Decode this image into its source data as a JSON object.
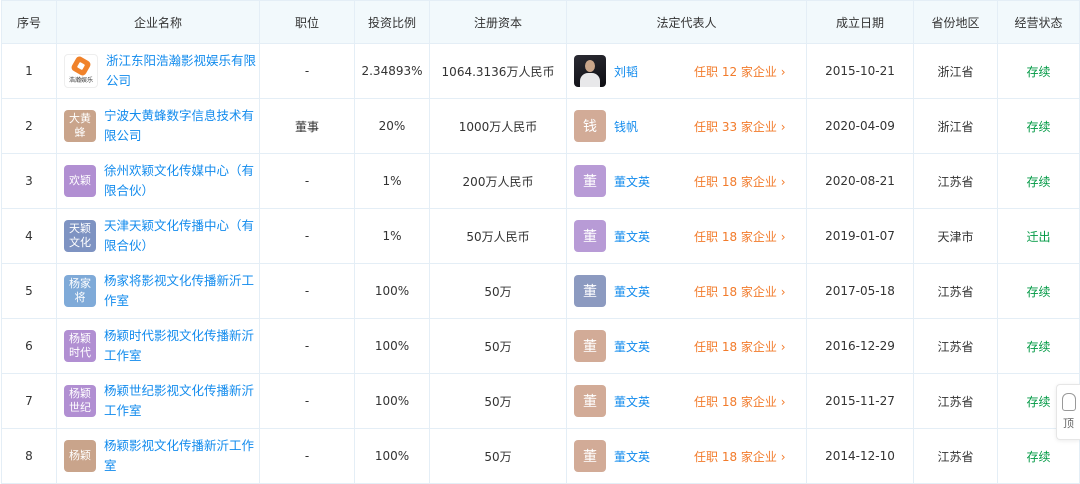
{
  "headers": [
    "序号",
    "企业名称",
    "职位",
    "投资比例",
    "注册资本",
    "法定代表人",
    "成立日期",
    "省份地区",
    "经营状态"
  ],
  "rows": [
    {
      "no": "1",
      "company": "浙江东阳浩瀚影视娱乐有限公司",
      "logo_text": "浩瀚娱乐",
      "logo_type": "image",
      "position": "-",
      "ratio": "2.34893%",
      "capital": "1064.3136万人民币",
      "rep": "刘韬",
      "rep_avatar": "",
      "rep_avatar_type": "photo",
      "roles": "任职 12 家企业 ›",
      "date": "2015-10-21",
      "region": "浙江省",
      "status": "存续"
    },
    {
      "no": "2",
      "company": "宁波大黄蜂数字信息技术有限公司",
      "logo_text": "大黄蜂",
      "logo_type": "text",
      "logo_color": "#c9a48b",
      "position": "董事",
      "ratio": "20%",
      "capital": "1000万人民币",
      "rep": "钱帆",
      "rep_avatar": "钱",
      "rep_avatar_color": "#d2ab97",
      "roles": "任职 33 家企业 ›",
      "date": "2020-04-09",
      "region": "浙江省",
      "status": "存续"
    },
    {
      "no": "3",
      "company": "徐州欢颖文化传媒中心（有限合伙）",
      "logo_text": "欢颖",
      "logo_type": "text",
      "logo_color": "#b18fd2",
      "position": "-",
      "ratio": "1%",
      "capital": "200万人民币",
      "rep": "董文英",
      "rep_avatar": "董",
      "rep_avatar_color": "#b89bd6",
      "roles": "任职 18 家企业 ›",
      "date": "2020-08-21",
      "region": "江苏省",
      "status": "存续"
    },
    {
      "no": "4",
      "company": "天津天颖文化传播中心（有限合伙）",
      "logo_text": "天颖文化",
      "logo_type": "text",
      "logo_color": "#7e93c2",
      "position": "-",
      "ratio": "1%",
      "capital": "50万人民币",
      "rep": "董文英",
      "rep_avatar": "董",
      "rep_avatar_color": "#b89bd6",
      "roles": "任职 18 家企业 ›",
      "date": "2019-01-07",
      "region": "天津市",
      "status": "迁出"
    },
    {
      "no": "5",
      "company": "杨家将影视文化传播新沂工作室",
      "logo_text": "杨家将",
      "logo_type": "text",
      "logo_color": "#7faad8",
      "position": "-",
      "ratio": "100%",
      "capital": "50万",
      "rep": "董文英",
      "rep_avatar": "董",
      "rep_avatar_color": "#8c9ac0",
      "roles": "任职 18 家企业 ›",
      "date": "2017-05-18",
      "region": "江苏省",
      "status": "存续"
    },
    {
      "no": "6",
      "company": "杨颖时代影视文化传播新沂工作室",
      "logo_text": "杨颖时代",
      "logo_type": "text",
      "logo_color": "#b18fd2",
      "position": "-",
      "ratio": "100%",
      "capital": "50万",
      "rep": "董文英",
      "rep_avatar": "董",
      "rep_avatar_color": "#d2ab97",
      "roles": "任职 18 家企业 ›",
      "date": "2016-12-29",
      "region": "江苏省",
      "status": "存续"
    },
    {
      "no": "7",
      "company": "杨颖世纪影视文化传播新沂工作室",
      "logo_text": "杨颖世纪",
      "logo_type": "text",
      "logo_color": "#b18fd2",
      "position": "-",
      "ratio": "100%",
      "capital": "50万",
      "rep": "董文英",
      "rep_avatar": "董",
      "rep_avatar_color": "#d2ab97",
      "roles": "任职 18 家企业 ›",
      "date": "2015-11-27",
      "region": "江苏省",
      "status": "存续"
    },
    {
      "no": "8",
      "company": "杨颖影视文化传播新沂工作室",
      "logo_text": "杨颖",
      "logo_type": "text",
      "logo_color": "#c9a48b",
      "position": "-",
      "ratio": "100%",
      "capital": "50万",
      "rep": "董文英",
      "rep_avatar": "董",
      "rep_avatar_color": "#d2ab97",
      "roles": "任职 18 家企业 ›",
      "date": "2014-12-10",
      "region": "江苏省",
      "status": "存续"
    }
  ],
  "side_button": {
    "icon": "rocket-icon",
    "label": "顶"
  }
}
